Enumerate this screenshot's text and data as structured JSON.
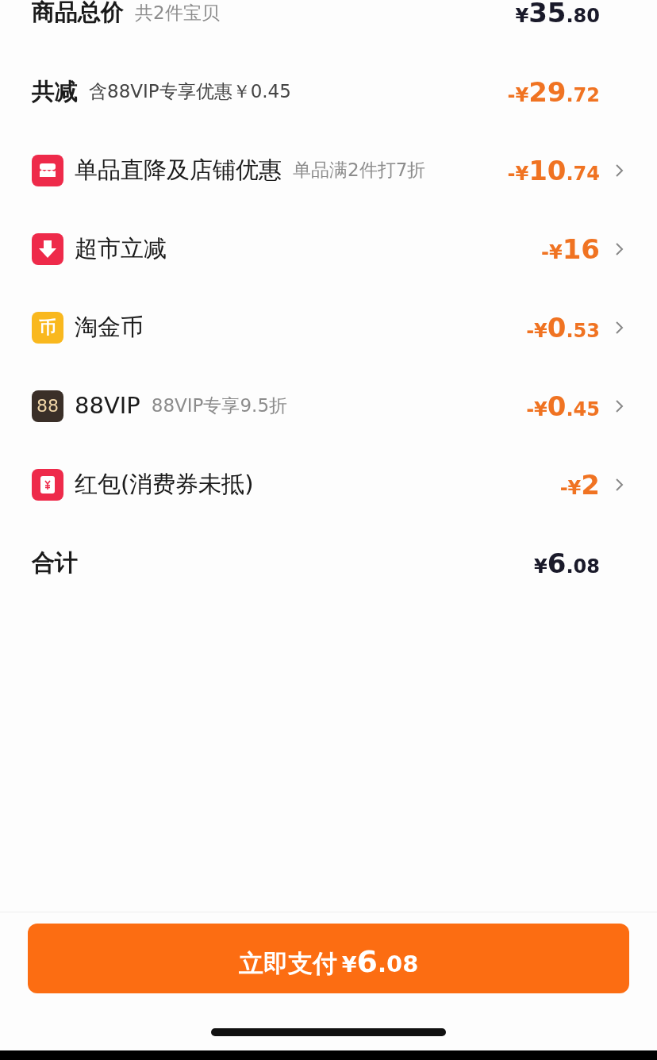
{
  "rows": [
    {
      "kind": "subtotal",
      "label": "商品总价",
      "note": "共2件宝贝",
      "amount": {
        "prefix": "¥",
        "whole": "35",
        "fraction": ".80"
      }
    },
    {
      "kind": "saving",
      "label": "共减",
      "note": "含88VIP专享优惠￥0.45",
      "amount": {
        "prefix": "-¥",
        "whole": "29",
        "fraction": ".72"
      }
    },
    {
      "kind": "shop",
      "label": "单品直降及店铺优惠",
      "note": "单品满2件打7折",
      "amount": {
        "prefix": "-¥",
        "whole": "10",
        "fraction": ".74"
      }
    },
    {
      "kind": "instant",
      "label": "超市立减",
      "amount": {
        "prefix": "-¥",
        "whole": "16"
      }
    },
    {
      "kind": "coin",
      "icon_text": "币",
      "label": "淘金币",
      "amount": {
        "prefix": "-¥",
        "whole": "0",
        "fraction": ".53"
      }
    },
    {
      "kind": "vip",
      "icon_text": "88",
      "label": "88VIP",
      "note": "88VIP专享9.5折",
      "amount": {
        "prefix": "-¥",
        "whole": "0",
        "fraction": ".45"
      }
    },
    {
      "kind": "packet",
      "label": "红包(消费券未抵)",
      "amount": {
        "prefix": "-¥",
        "whole": "2"
      }
    },
    {
      "kind": "total",
      "label": "合计",
      "amount": {
        "prefix": "¥",
        "whole": "6",
        "fraction": ".08"
      }
    }
  ],
  "pay_button": {
    "label": "立即支付",
    "amount": {
      "prefix": "¥",
      "whole": "6",
      "fraction": ".08"
    }
  }
}
